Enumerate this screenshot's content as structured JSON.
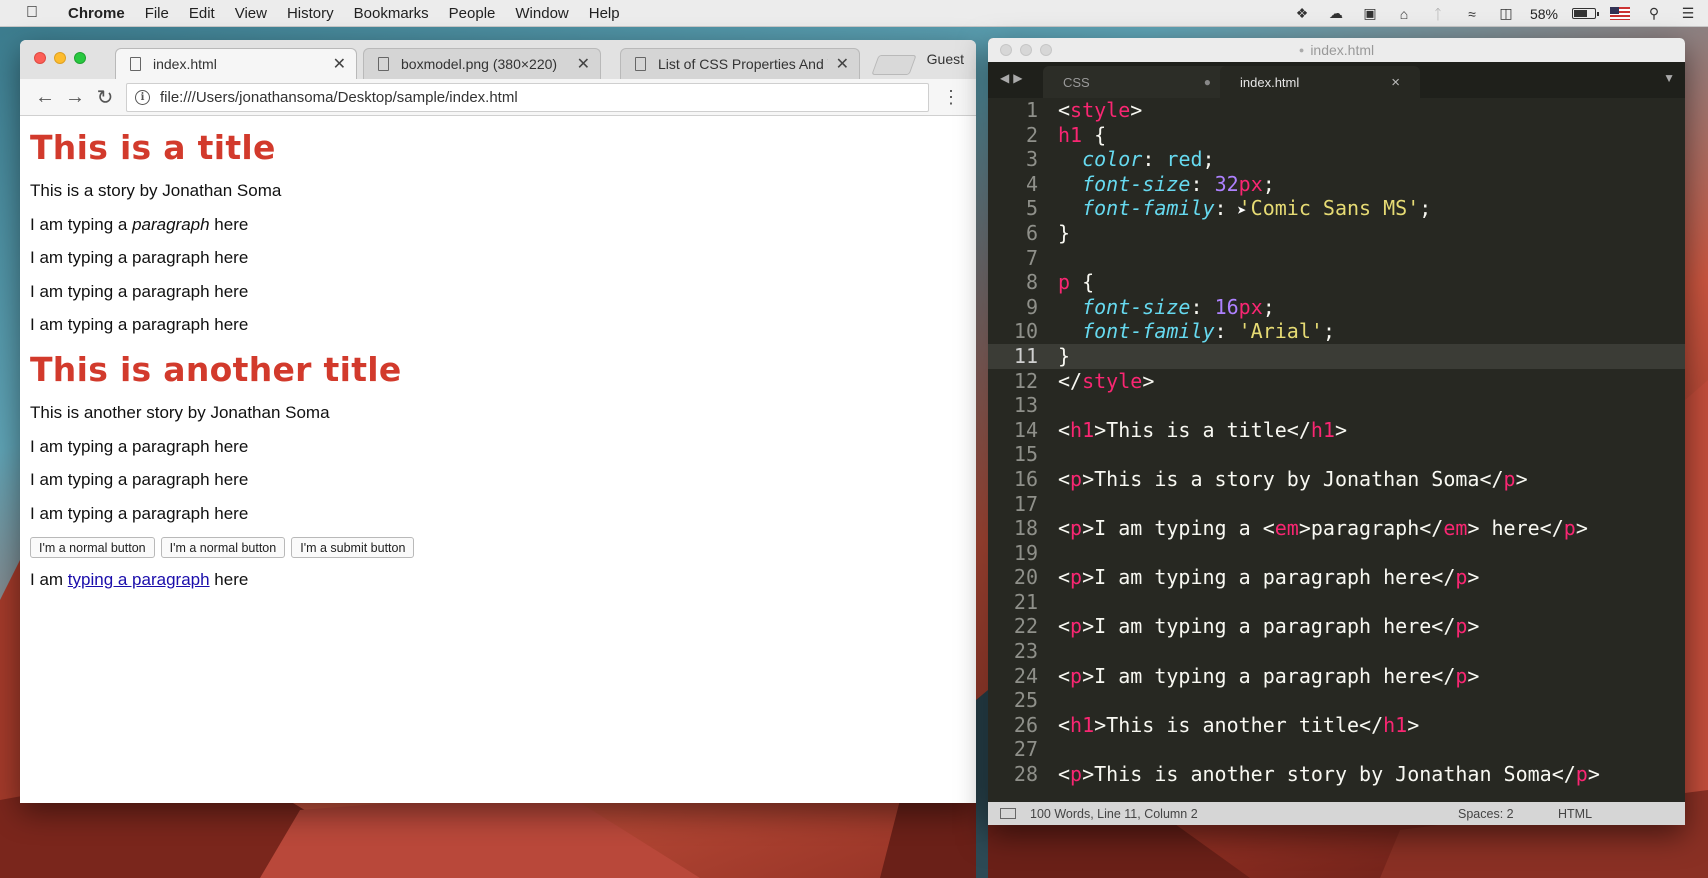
{
  "menubar": {
    "items": [
      "Chrome",
      "File",
      "Edit",
      "View",
      "History",
      "Bookmarks",
      "People",
      "Window",
      "Help"
    ],
    "battery_percent": "58%",
    "battery_level": 0.58,
    "icons": [
      "dropbox-icon",
      "cloud-icon",
      "video-icon",
      "home-icon",
      "bluetooth-icon",
      "wifi-icon",
      "airplay-icon",
      "battery-icon",
      "flag-icon",
      "search-icon",
      "list-icon"
    ]
  },
  "chrome": {
    "tabs": [
      {
        "title": "index.html"
      },
      {
        "title": "boxmodel.png (380×220)"
      },
      {
        "title": "List of CSS Properties And V"
      }
    ],
    "guest": "Guest",
    "url": "file:///Users/jonathansoma/Desktop/sample/index.html",
    "page": {
      "title1": "This is a title",
      "story1": "This is a story by Jonathan Soma",
      "p_em_before": "I am typing a ",
      "p_em_word": "paragraph",
      "p_em_after": " here",
      "paragraph": "I am typing a paragraph here",
      "title2": "This is another title",
      "story2": "This is another story by Jonathan Soma",
      "button1": "I'm a normal button",
      "button2": "I'm a normal button",
      "button3": "I'm a submit button",
      "link_before": "I am ",
      "link_text": "typing a paragraph",
      "link_after": " here"
    }
  },
  "sublime": {
    "window_title": "index.html",
    "tabs": [
      {
        "title": "CSS",
        "modified": "●"
      },
      {
        "title": "index.html",
        "close": "×"
      }
    ],
    "current_line": 11,
    "lines": [
      [
        [
          "t-txt",
          "<"
        ],
        [
          "t-tag",
          "style"
        ],
        [
          "t-txt",
          ">"
        ]
      ],
      [
        [
          "t-tag",
          "h1"
        ],
        [
          "t-txt",
          " {"
        ]
      ],
      [
        [
          "t-txt",
          "  "
        ],
        [
          "t-prop",
          "color"
        ],
        [
          "t-txt",
          ": "
        ],
        [
          "t-kw",
          "red"
        ],
        [
          "t-txt",
          ";"
        ]
      ],
      [
        [
          "t-txt",
          "  "
        ],
        [
          "t-prop",
          "font-size"
        ],
        [
          "t-txt",
          ": "
        ],
        [
          "t-num",
          "32"
        ],
        [
          "t-unit",
          "px"
        ],
        [
          "t-txt",
          ";"
        ]
      ],
      [
        [
          "t-txt",
          "  "
        ],
        [
          "t-prop",
          "font-family"
        ],
        [
          "t-txt",
          ": "
        ],
        [
          "t-str",
          "'Comic Sans MS'"
        ],
        [
          "t-txt",
          ";"
        ]
      ],
      [
        [
          "t-txt",
          "}"
        ]
      ],
      [],
      [
        [
          "t-tag",
          "p"
        ],
        [
          "t-txt",
          " {"
        ]
      ],
      [
        [
          "t-txt",
          "  "
        ],
        [
          "t-prop",
          "font-size"
        ],
        [
          "t-txt",
          ": "
        ],
        [
          "t-num",
          "16"
        ],
        [
          "t-unit",
          "px"
        ],
        [
          "t-txt",
          ";"
        ]
      ],
      [
        [
          "t-txt",
          "  "
        ],
        [
          "t-prop",
          "font-family"
        ],
        [
          "t-txt",
          ": "
        ],
        [
          "t-str",
          "'Arial'"
        ],
        [
          "t-txt",
          ";"
        ]
      ],
      [
        [
          "t-txt",
          "}"
        ]
      ],
      [
        [
          "t-txt",
          "</"
        ],
        [
          "t-tag",
          "style"
        ],
        [
          "t-txt",
          ">"
        ]
      ],
      [],
      [
        [
          "t-txt",
          "<"
        ],
        [
          "t-tag",
          "h1"
        ],
        [
          "t-txt",
          ">This is a title</"
        ],
        [
          "t-tag",
          "h1"
        ],
        [
          "t-txt",
          ">"
        ]
      ],
      [],
      [
        [
          "t-txt",
          "<"
        ],
        [
          "t-tag",
          "p"
        ],
        [
          "t-txt",
          ">This is a story by Jonathan Soma</"
        ],
        [
          "t-tag",
          "p"
        ],
        [
          "t-txt",
          ">"
        ]
      ],
      [],
      [
        [
          "t-txt",
          "<"
        ],
        [
          "t-tag",
          "p"
        ],
        [
          "t-txt",
          ">I am typing a <"
        ],
        [
          "t-tag",
          "em"
        ],
        [
          "t-txt",
          ">paragraph</"
        ],
        [
          "t-tag",
          "em"
        ],
        [
          "t-txt",
          "> here</"
        ],
        [
          "t-tag",
          "p"
        ],
        [
          "t-txt",
          ">"
        ]
      ],
      [],
      [
        [
          "t-txt",
          "<"
        ],
        [
          "t-tag",
          "p"
        ],
        [
          "t-txt",
          ">I am typing a paragraph here</"
        ],
        [
          "t-tag",
          "p"
        ],
        [
          "t-txt",
          ">"
        ]
      ],
      [],
      [
        [
          "t-txt",
          "<"
        ],
        [
          "t-tag",
          "p"
        ],
        [
          "t-txt",
          ">I am typing a paragraph here</"
        ],
        [
          "t-tag",
          "p"
        ],
        [
          "t-txt",
          ">"
        ]
      ],
      [],
      [
        [
          "t-txt",
          "<"
        ],
        [
          "t-tag",
          "p"
        ],
        [
          "t-txt",
          ">I am typing a paragraph here</"
        ],
        [
          "t-tag",
          "p"
        ],
        [
          "t-txt",
          ">"
        ]
      ],
      [],
      [
        [
          "t-txt",
          "<"
        ],
        [
          "t-tag",
          "h1"
        ],
        [
          "t-txt",
          ">This is another title</"
        ],
        [
          "t-tag",
          "h1"
        ],
        [
          "t-txt",
          ">"
        ]
      ],
      [],
      [
        [
          "t-txt",
          "<"
        ],
        [
          "t-tag",
          "p"
        ],
        [
          "t-txt",
          ">This is another story by Jonathan Soma</"
        ],
        [
          "t-tag",
          "p"
        ],
        [
          "t-txt",
          ">"
        ]
      ],
      []
    ],
    "status": {
      "info": "100 Words, Line 11, Column 2",
      "spaces": "Spaces: 2",
      "syntax": "HTML"
    }
  }
}
